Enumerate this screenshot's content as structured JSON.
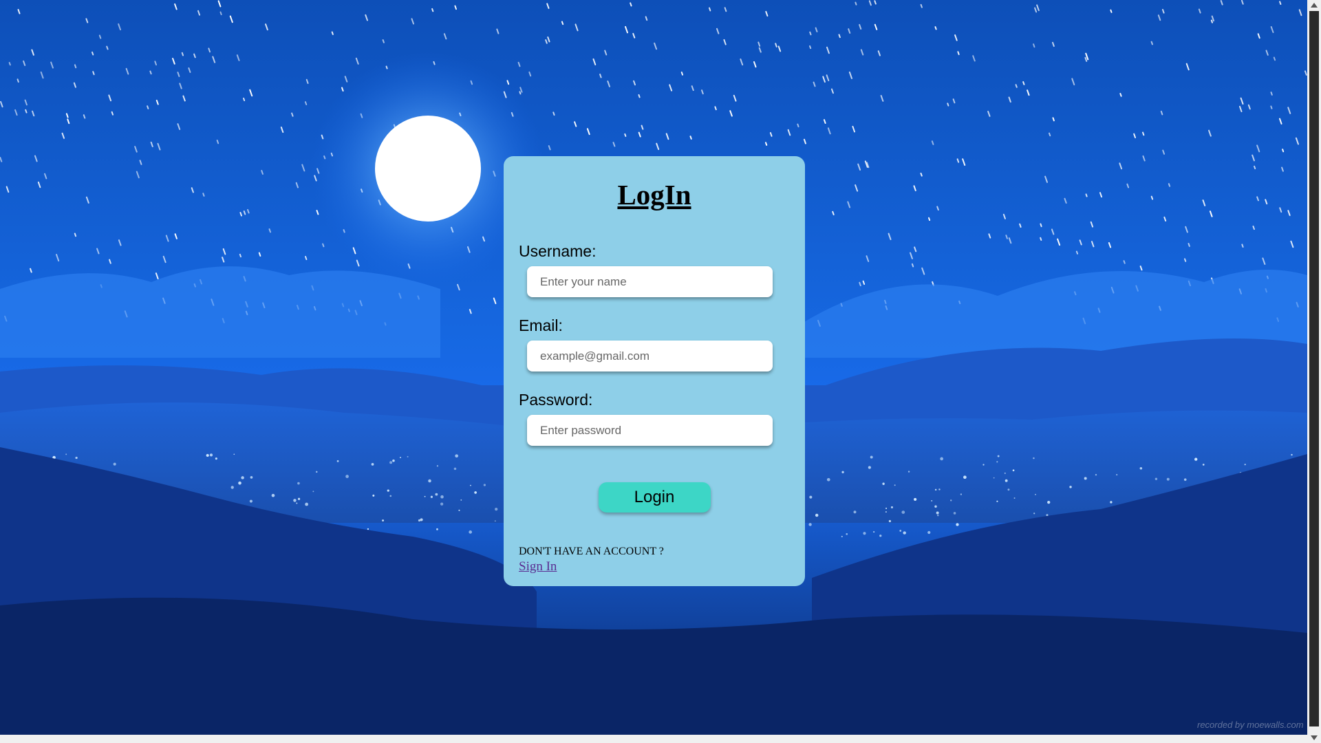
{
  "form": {
    "title": "LogIn",
    "username_label": "Username:",
    "username_placeholder": "Enter your name",
    "email_label": "Email:",
    "email_placeholder": "example@gmail.com",
    "password_label": "Password:",
    "password_placeholder": "Enter password",
    "login_button": "Login",
    "no_account_text": "DON'T HAVE AN ACCOUNT ?",
    "signin_link": "Sign In"
  },
  "watermark": "recorded by moewalls.com",
  "colors": {
    "card_background": "#8ecfe8",
    "login_button": "#3dd6c6",
    "link": "#5a2d91",
    "sky": "#1556c8"
  },
  "icons": [
    "moon",
    "scroll-up-arrow",
    "scroll-down-arrow"
  ]
}
